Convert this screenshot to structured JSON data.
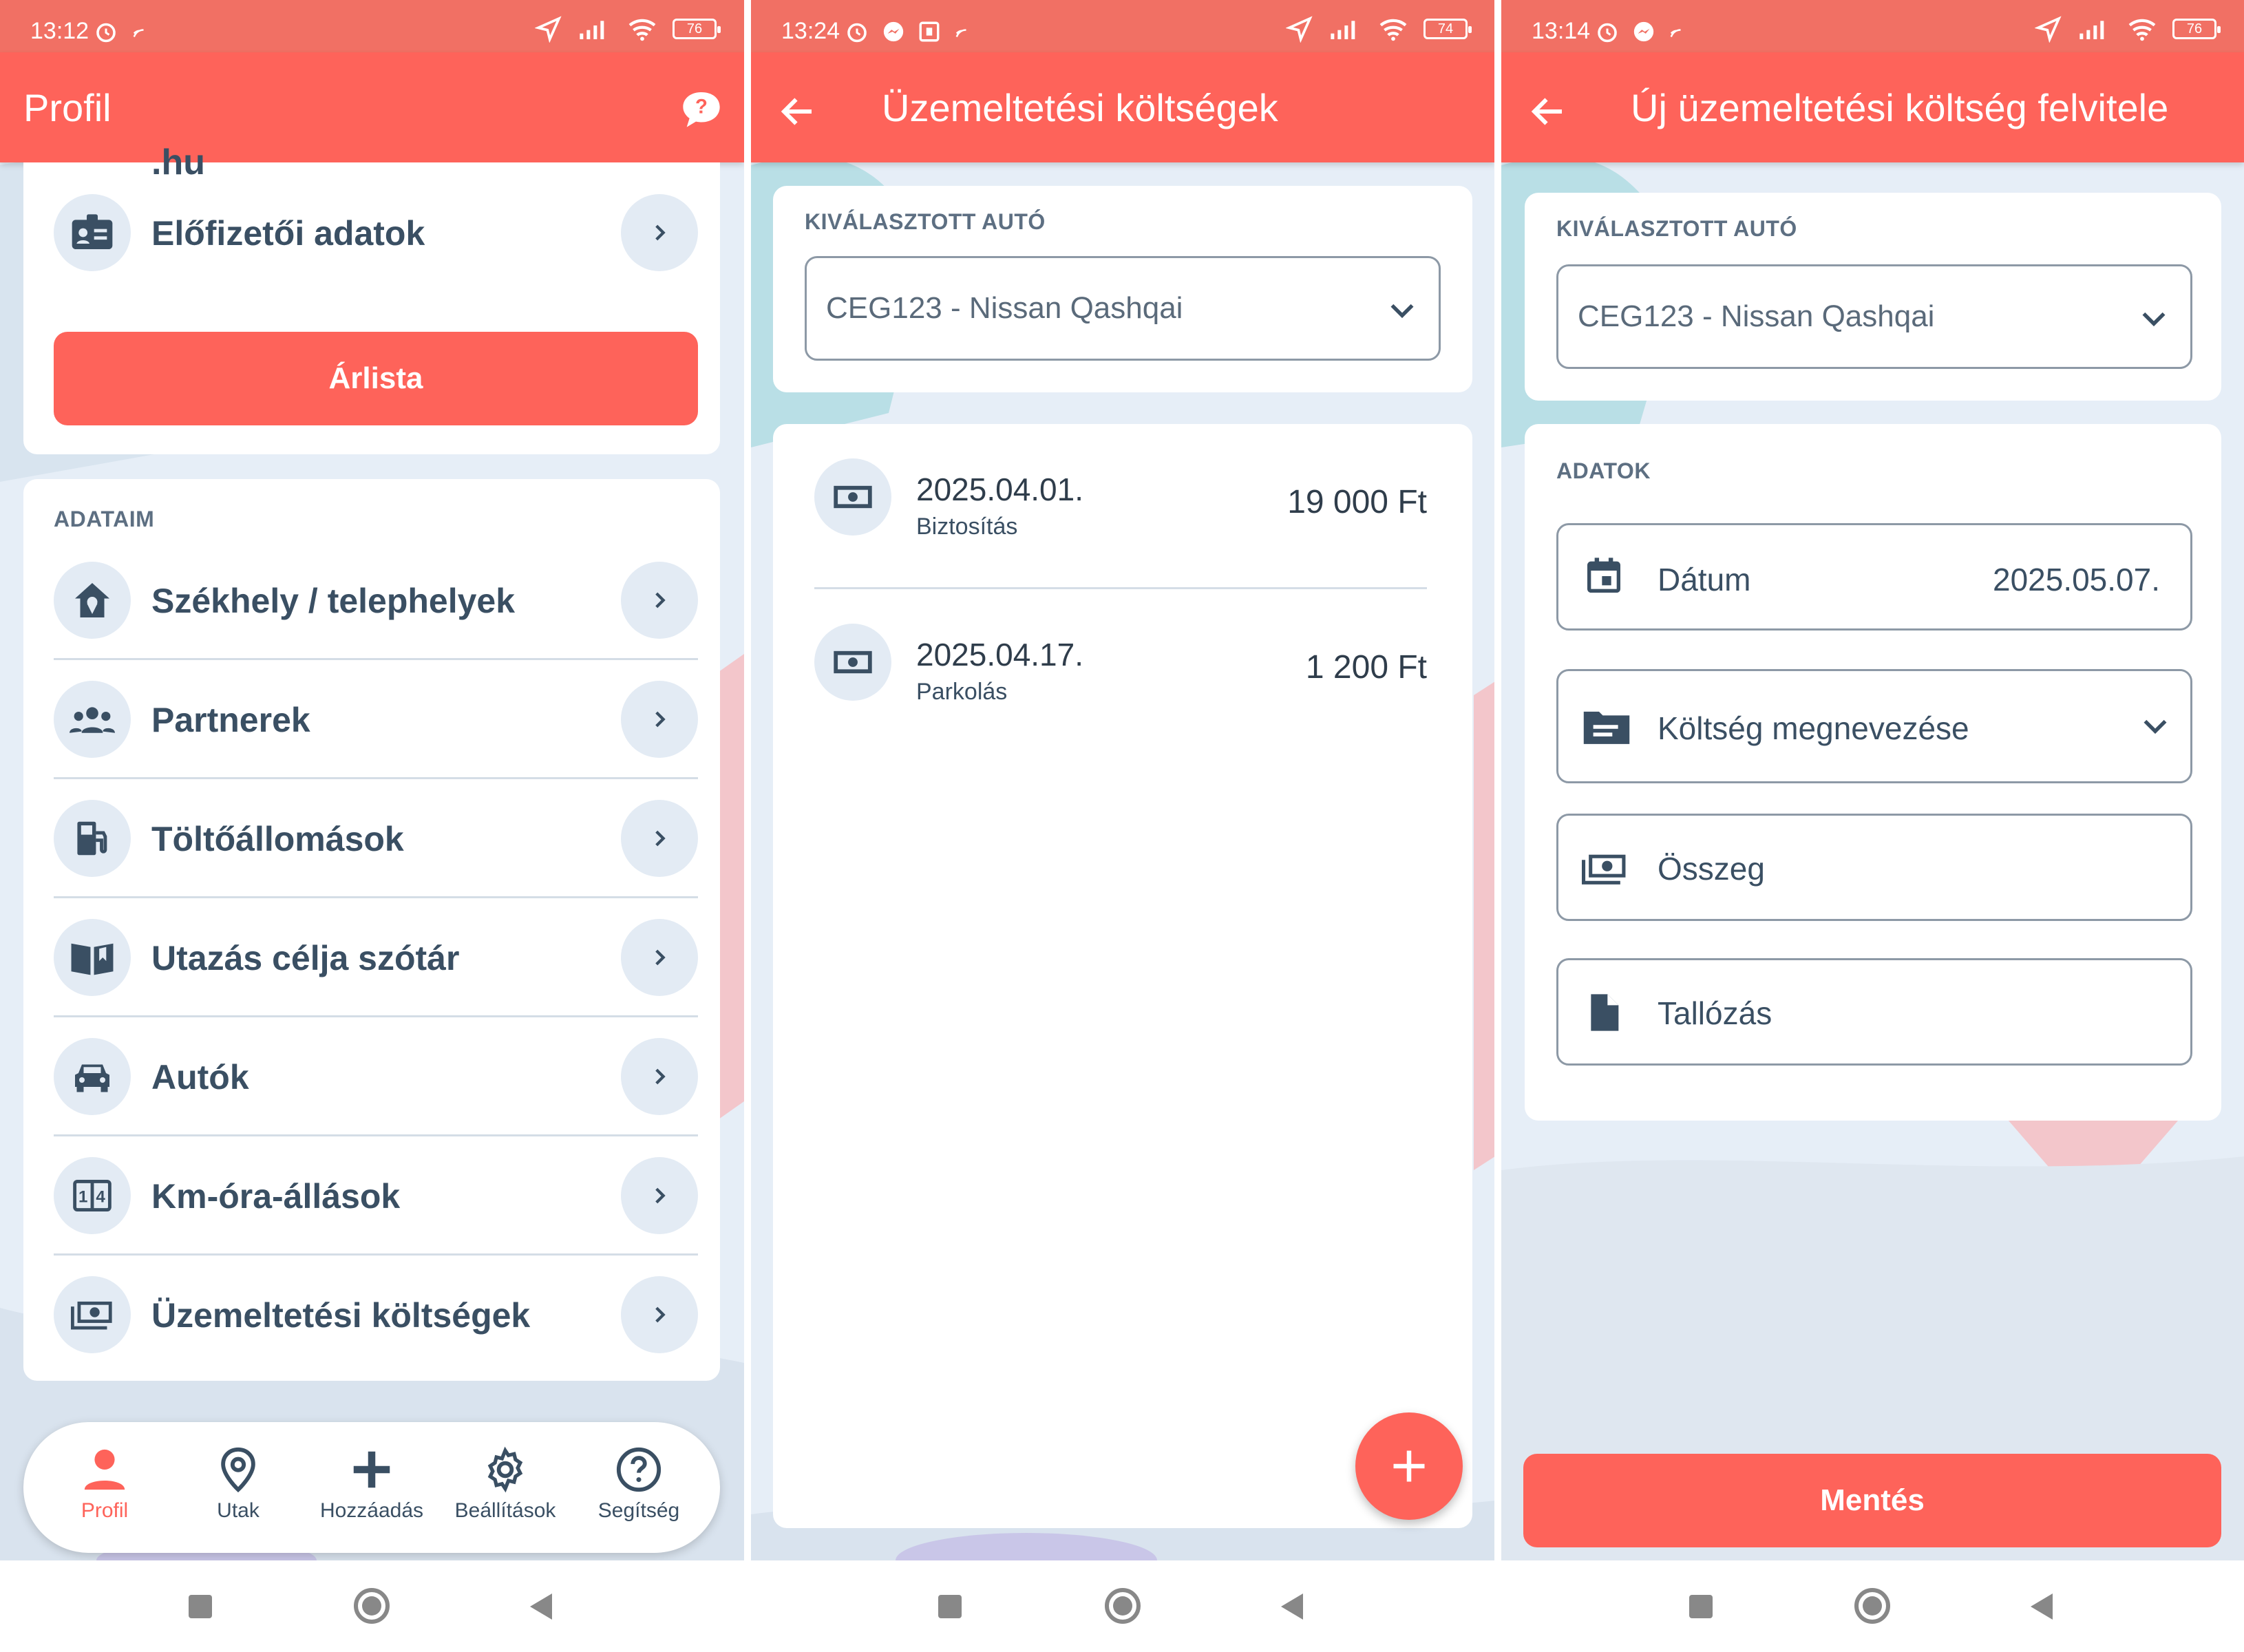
{
  "screen1": {
    "status": {
      "time": "13:12",
      "battery": "76"
    },
    "appbar": {
      "title": "Profil"
    },
    "partial_text": ".hu",
    "subscriber_row": {
      "label": "Előfizetői adatok",
      "icon": "id-card-icon"
    },
    "price_button": "Árlista",
    "section_label": "ADATAIM",
    "rows": [
      {
        "label": "Székhely / telephelyek",
        "icon": "home-location-icon"
      },
      {
        "label": "Partnerek",
        "icon": "group-icon"
      },
      {
        "label": "Töltőállomások",
        "icon": "fuel-station-icon"
      },
      {
        "label": "Utazás célja szótár",
        "icon": "book-icon"
      },
      {
        "label": "Autók",
        "icon": "car-icon"
      },
      {
        "label": "Km-óra-állások",
        "icon": "odometer-icon"
      },
      {
        "label": "Üzemeltetési költségek",
        "icon": "money-icon"
      }
    ],
    "nav": [
      {
        "label": "Profil",
        "icon": "person-icon",
        "active": true
      },
      {
        "label": "Utak",
        "icon": "map-pin-icon",
        "active": false
      },
      {
        "label": "Hozzáadás",
        "icon": "plus-icon",
        "active": false
      },
      {
        "label": "Beállítások",
        "icon": "gear-icon",
        "active": false
      },
      {
        "label": "Segítség",
        "icon": "help-icon",
        "active": false
      }
    ]
  },
  "screen2": {
    "status": {
      "time": "13:24",
      "battery": "74"
    },
    "appbar": {
      "title": "Üzemeltetési költségek"
    },
    "section_label": "KIVÁLASZTOTT AUTÓ",
    "selected_car": "CEG123 - Nissan Qashqai",
    "entries": [
      {
        "date": "2025.04.01.",
        "category": "Biztosítás",
        "amount": "19 000 Ft"
      },
      {
        "date": "2025.04.17.",
        "category": "Parkolás",
        "amount": "1 200 Ft"
      }
    ]
  },
  "screen3": {
    "status": {
      "time": "13:14",
      "battery": "76"
    },
    "appbar": {
      "title": "Új üzemeltetési költség felvitele"
    },
    "section_label": "KIVÁLASZTOTT AUTÓ",
    "selected_car": "CEG123 - Nissan Qashqai",
    "data_label": "ADATOK",
    "date_field": {
      "label": "Dátum",
      "value": "2025.05.07."
    },
    "cost_name_placeholder": "Költség megnevezése",
    "amount_placeholder": "Összeg",
    "browse_label": "Tallózás",
    "save_button": "Mentés"
  },
  "colors": {
    "primary": "#fe635a",
    "statusbar": "#f17064",
    "text": "#3a4f63",
    "background": "#e6eef7"
  }
}
